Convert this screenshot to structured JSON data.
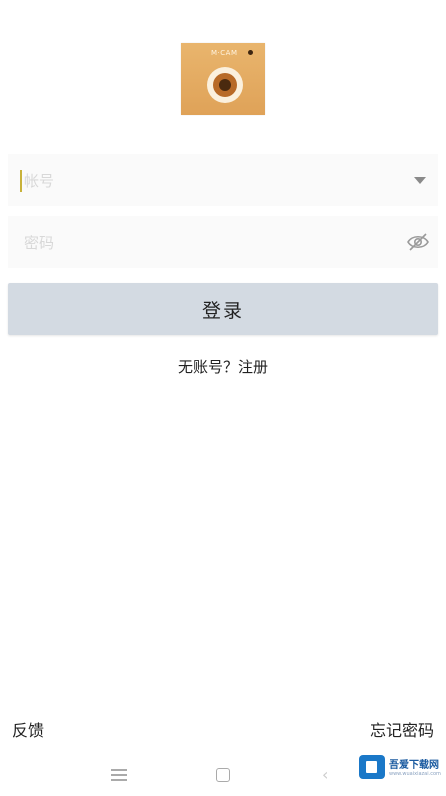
{
  "logo": {
    "label": "M·CAM",
    "bg_color": "#e3a95f"
  },
  "account_field": {
    "placeholder": "帐号",
    "value": "",
    "trailing_icon": "dropdown-arrow-icon"
  },
  "password_field": {
    "placeholder": "密码",
    "value": "",
    "trailing_icon": "eye-off-icon"
  },
  "login_button": {
    "label": "登录",
    "bg_color": "#d3dae2"
  },
  "register": {
    "label": "无账号？注册"
  },
  "footer": {
    "feedback_label": "反馈",
    "forgot_password_label": "忘记密码"
  },
  "system_nav": {
    "icons": [
      "menu-icon",
      "home-icon",
      "back-icon"
    ],
    "back_glyph": "‹"
  },
  "watermark": {
    "text": "吾爱下载网",
    "subtext": "www.wuaixiazai.com"
  }
}
